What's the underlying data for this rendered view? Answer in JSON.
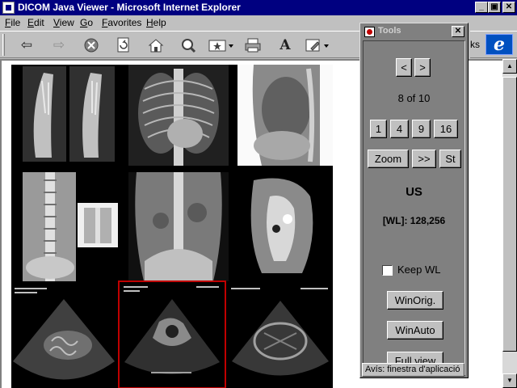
{
  "window": {
    "title": "DICOM Java Viewer - Microsoft Internet Explorer",
    "minimize": "_",
    "maximize": "▣",
    "close": "✕"
  },
  "menu": [
    {
      "label": "File"
    },
    {
      "label": "Edit"
    },
    {
      "label": "View"
    },
    {
      "label": "Go"
    },
    {
      "label": "Favorites"
    },
    {
      "label": "Help"
    }
  ],
  "toolbar": {
    "icons": [
      "back-icon",
      "forward-icon",
      "stop-icon",
      "refresh-icon",
      "home-icon",
      "search-icon",
      "favorites-icon",
      "print-icon",
      "font-icon",
      "edit-icon"
    ],
    "links_fragment": "ks",
    "ie_logo": "e"
  },
  "thumbnails": [
    {
      "name": "thumb-feet-xray",
      "type": "xray"
    },
    {
      "name": "thumb-chest-pa-xray",
      "type": "xray"
    },
    {
      "name": "thumb-chest-lateral-xray",
      "type": "xray"
    },
    {
      "name": "thumb-spine-xray",
      "type": "xray"
    },
    {
      "name": "thumb-abdomen-xray",
      "type": "xray"
    },
    {
      "name": "thumb-mri",
      "type": "mri"
    },
    {
      "name": "thumb-us-1",
      "type": "ultrasound"
    },
    {
      "name": "thumb-us-2",
      "type": "ultrasound",
      "selected": true
    },
    {
      "name": "thumb-us-3",
      "type": "ultrasound"
    }
  ],
  "tools": {
    "title": "Tools",
    "close": "✕",
    "prev": "<",
    "next": ">",
    "position": "8 of 10",
    "layout_buttons": [
      "1",
      "4",
      "9",
      "16"
    ],
    "zoom": "Zoom",
    "forward": ">>",
    "st": "St",
    "modality": "US",
    "wl": "[WL]: 128,256",
    "keep_wl": "Keep WL",
    "keep_wl_checked": false,
    "win_orig": "WinOrig.",
    "win_auto": "WinAuto",
    "full_view": "Full view",
    "status": "Avís: finestra d'aplicació"
  },
  "colors": {
    "titlebar": "#000080",
    "selection": "#c00000",
    "panel": "#808080"
  }
}
